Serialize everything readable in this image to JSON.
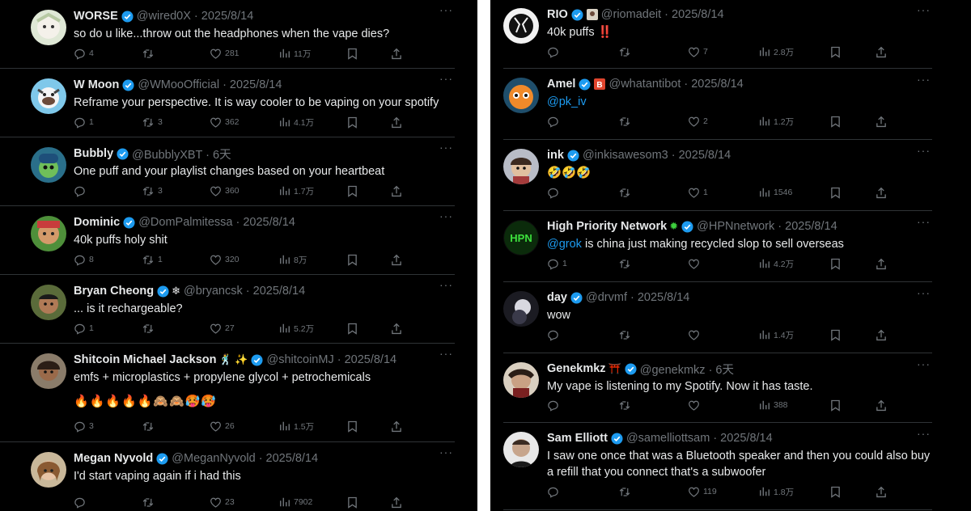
{
  "icons": {
    "reply": "reply-icon",
    "retweet": "retweet-icon",
    "like": "heart-icon",
    "views": "views-icon",
    "bookmark": "bookmark-icon",
    "share": "share-icon",
    "more": "more-icon",
    "verified": "verified-badge-icon"
  },
  "colors": {
    "background": "#000000",
    "text": "#e7e9ea",
    "muted": "#71767b",
    "accent": "#1d9bf0",
    "divider": "#2f3336"
  },
  "left_tweets": [
    {
      "name": "WORSE",
      "handle": "@wired0X · 2025/8/14",
      "text": "so do u like...throw out the headphones when the vape dies?",
      "replies": "4",
      "retweets": "",
      "likes": "281",
      "views": "11万"
    },
    {
      "name": "W Moon",
      "handle": "@WMooOfficial · 2025/8/14",
      "text": "Reframe your perspective. It is way cooler to be vaping on your spotify",
      "replies": "1",
      "retweets": "3",
      "likes": "362",
      "views": "4.1万"
    },
    {
      "name": "Bubbly",
      "handle": "@BubblyXBT · 6天",
      "text": "One puff and your playlist changes based on your heartbeat",
      "replies": "",
      "retweets": "3",
      "likes": "360",
      "views": "1.7万"
    },
    {
      "name": "Dominic",
      "handle": "@DomPalmitessa · 2025/8/14",
      "text": "40k puffs holy shit",
      "replies": "8",
      "retweets": "1",
      "likes": "320",
      "views": "8万"
    },
    {
      "name": "Bryan Cheong",
      "extra": "❄",
      "handle": "@bryancsk · 2025/8/14",
      "text": "... is it rechargeable?",
      "replies": "1",
      "retweets": "",
      "likes": "27",
      "views": "5.2万"
    },
    {
      "name": "Shitcoin Michael Jackson",
      "extra": "🕺 ✨",
      "handle": "@shitcoinMJ · 2025/8/14",
      "text": "emfs + microplastics + propylene glycol + petrochemicals",
      "emoji_line": "🔥🔥🔥🔥🔥🙈🙈🥵🥵",
      "replies": "3",
      "retweets": "",
      "likes": "26",
      "views": "1.5万"
    },
    {
      "name": "Megan Nyvold",
      "handle": "@MeganNyvold · 2025/8/14",
      "text": "I'd start vaping again if i had this",
      "replies": "",
      "retweets": "",
      "likes": "23",
      "views": "7902"
    }
  ],
  "right_tweets": [
    {
      "name": "RIO",
      "handle": "@riomadeit · 2025/8/14",
      "text": "40k puffs ‼️",
      "replies": "",
      "retweets": "",
      "likes": "7",
      "views": "2.8万"
    },
    {
      "name": "Amel",
      "badge": "B",
      "handle": "@whatantibot · 2025/8/14",
      "mention": "@pk_iv",
      "text": "",
      "replies": "",
      "retweets": "",
      "likes": "2",
      "views": "1.2万"
    },
    {
      "name": "ink",
      "handle": "@inkisawesom3 · 2025/8/14",
      "text": "🤣🤣🤣",
      "replies": "",
      "retweets": "",
      "likes": "1",
      "views": "1546"
    },
    {
      "name": "High Priority Network",
      "extra": "✹",
      "handle": "@HPNnetwork · 2025/8/14",
      "mention": "@grok",
      "text": " is china just making recycled slop to sell overseas",
      "replies": "1",
      "retweets": "",
      "likes": "",
      "views": "4.2万"
    },
    {
      "name": "day",
      "handle": "@drvmf · 2025/8/14",
      "text": "wow",
      "replies": "",
      "retweets": "",
      "likes": "",
      "views": "1.4万"
    },
    {
      "name": "Genekmkz",
      "extra": "⛩️",
      "handle": "@genekmkz · 6天",
      "text": "My vape is listening to my Spotify. Now it has taste.",
      "replies": "",
      "retweets": "",
      "likes": "",
      "views": "388"
    },
    {
      "name": "Sam Elliott",
      "handle": "@samelliottsam · 2025/8/14",
      "text": "I saw one once that was a Bluetooth speaker and then you could also buy a refill that you connect that's a subwoofer",
      "replies": "",
      "retweets": "",
      "likes": "119",
      "views": "1.8万"
    }
  ],
  "avatar_labels": {
    "hpn": "HPN"
  }
}
